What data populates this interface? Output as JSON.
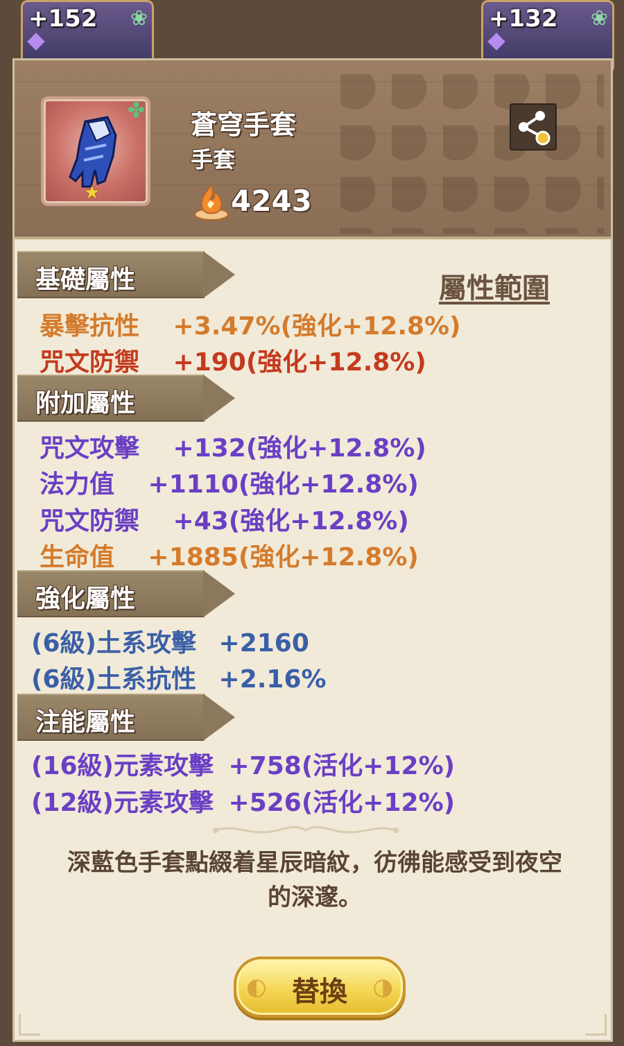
{
  "background": {
    "cards": [
      {
        "level": "+152"
      },
      {
        "level": "+132"
      }
    ]
  },
  "item": {
    "name": "蒼穹手套",
    "type": "手套",
    "power": "4243"
  },
  "range_link": "屬性範圍",
  "sections": {
    "base": {
      "title": "基礎屬性",
      "stats": [
        {
          "name": "暴擊抗性",
          "value": "+3.47%(強化+12.8%)",
          "color": "#d47b2c"
        },
        {
          "name": "咒文防禦",
          "value": "+190(強化+12.8%)",
          "color": "#c43a1e"
        }
      ]
    },
    "extra": {
      "title": "附加屬性",
      "stats": [
        {
          "name": "咒文攻擊",
          "value": "+132(強化+12.8%)",
          "color": "#6a3fc4"
        },
        {
          "name": "法力值",
          "value": "+1110(強化+12.8%)",
          "color": "#6a3fc4"
        },
        {
          "name": "咒文防禦",
          "value": "+43(強化+12.8%)",
          "color": "#6a3fc4"
        },
        {
          "name": "生命值",
          "value": "+1885(強化+12.8%)",
          "color": "#d47b2c"
        }
      ]
    },
    "enhance": {
      "title": "強化屬性",
      "stats": [
        {
          "name": "(6級)土系攻擊",
          "value": "+2160",
          "color": "#3a5fa6"
        },
        {
          "name": "(6級)土系抗性",
          "value": "+2.16%",
          "color": "#3a5fa6"
        }
      ]
    },
    "infuse": {
      "title": "注能屬性",
      "stats": [
        {
          "name": "(16級)元素攻擊",
          "value": "+758(活化+12%)",
          "color": "#6a3fc4"
        },
        {
          "name": "(12級)元素攻擊",
          "value": "+526(活化+12%)",
          "color": "#6a3fc4"
        }
      ]
    }
  },
  "description": "深藍色手套點綴着星辰暗紋，彷彿能感受到夜空的深邃。",
  "replace_button": "替換"
}
